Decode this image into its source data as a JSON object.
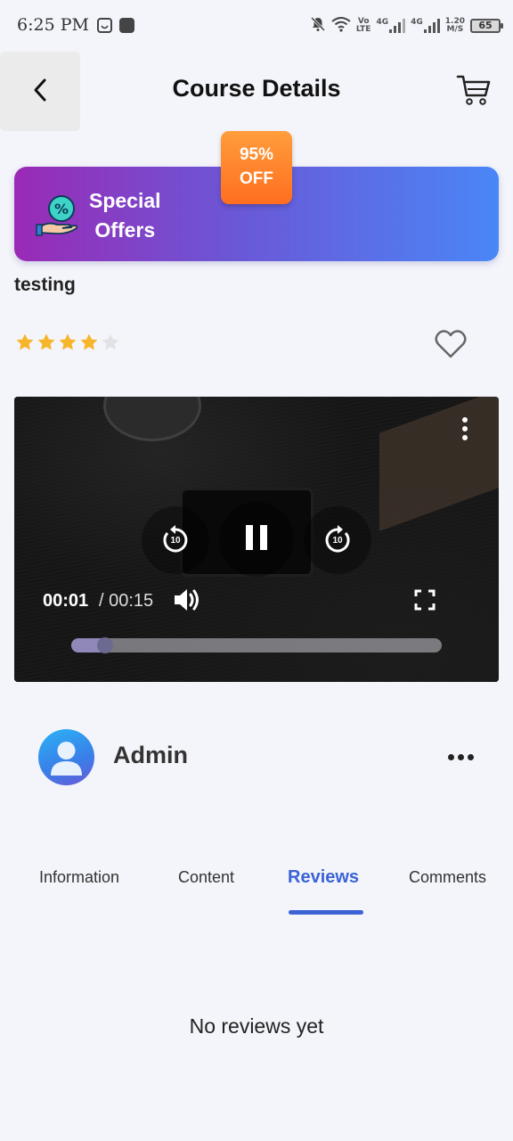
{
  "status_bar": {
    "time": "6:25 PM",
    "volte_top": "Vo",
    "volte_bottom": "LTE",
    "network_1": "4G",
    "network_2": "4G",
    "speed_top": "1.20",
    "speed_bottom": "M/S",
    "battery": "65"
  },
  "header": {
    "title": "Course Details"
  },
  "offer": {
    "line1": "Special",
    "line2": "Offers",
    "discount_line1": "95%",
    "discount_line2": "OFF"
  },
  "course": {
    "name": "testing",
    "rating": 4,
    "max_rating": 5
  },
  "video": {
    "current_time": "00:01",
    "separator_duration": "/ 00:15",
    "rewind_seconds": "10",
    "forward_seconds": "10",
    "progress_fraction": 0.07
  },
  "author": {
    "name": "Admin"
  },
  "tabs": [
    {
      "label": "Information"
    },
    {
      "label": "Content"
    },
    {
      "label": "Reviews"
    },
    {
      "label": "Comments"
    }
  ],
  "active_tab": "Reviews",
  "reviews": {
    "empty_message": "No reviews yet"
  },
  "colors": {
    "accent": "#3b63d6",
    "star": "#f7b52b",
    "banner_start": "#9a2ab6",
    "banner_end": "#4a86f7",
    "badge": "#ff7a26"
  }
}
